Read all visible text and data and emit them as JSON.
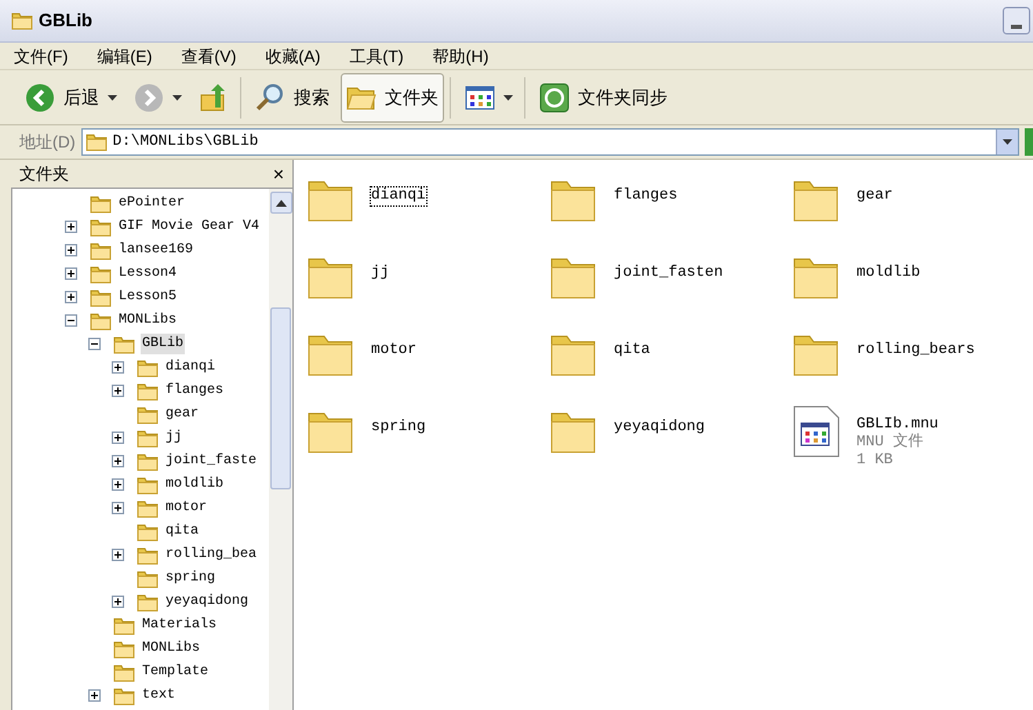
{
  "window": {
    "title": "GBLib"
  },
  "menu": [
    "文件(F)",
    "编辑(E)",
    "查看(V)",
    "收藏(A)",
    "工具(T)",
    "帮助(H)"
  ],
  "toolbar": [
    {
      "kind": "back",
      "label": "后退",
      "pressed": false
    },
    {
      "kind": "forward",
      "pressed": false
    },
    {
      "kind": "up",
      "pressed": false
    },
    {
      "kind": "search",
      "label": "搜索",
      "pressed": false
    },
    {
      "kind": "folders",
      "label": "文件夹",
      "pressed": true
    },
    {
      "kind": "views",
      "pressed": false
    },
    {
      "kind": "sync",
      "label": "文件夹同步",
      "pressed": false
    }
  ],
  "address": {
    "label": "地址(D)",
    "value": "D:\\MONLibs\\GBLib"
  },
  "folder_pane": {
    "title": "文件夹",
    "close": "×",
    "tree": [
      {
        "label": "ePointer",
        "kind": "leaf",
        "selected": false
      },
      {
        "label": "GIF Movie Gear V4",
        "kind": "branch",
        "expanded": false,
        "selected": false
      },
      {
        "label": "lansee169",
        "kind": "branch",
        "expanded": false,
        "selected": false
      },
      {
        "label": "Lesson4",
        "kind": "branch",
        "expanded": false,
        "selected": false
      },
      {
        "label": "Lesson5",
        "kind": "branch",
        "expanded": false,
        "selected": false
      },
      {
        "label": "MONLibs",
        "kind": "branch",
        "expanded": true,
        "selected": false,
        "children": [
          {
            "label": "GBLib",
            "kind": "branch",
            "expanded": true,
            "selected": true,
            "children": [
              {
                "label": "dianqi",
                "kind": "branch",
                "expanded": false,
                "selected": false
              },
              {
                "label": "flanges",
                "kind": "branch",
                "expanded": false,
                "selected": false
              },
              {
                "label": "gear",
                "kind": "leaf",
                "selected": false
              },
              {
                "label": "jj",
                "kind": "branch",
                "expanded": false,
                "selected": false
              },
              {
                "label": "joint_faste",
                "kind": "branch",
                "expanded": false,
                "selected": false
              },
              {
                "label": "moldlib",
                "kind": "branch",
                "expanded": false,
                "selected": false
              },
              {
                "label": "motor",
                "kind": "branch",
                "expanded": false,
                "selected": false
              },
              {
                "label": "qita",
                "kind": "leaf",
                "selected": false
              },
              {
                "label": "rolling_bea",
                "kind": "branch",
                "expanded": false,
                "selected": false
              },
              {
                "label": "spring",
                "kind": "leaf",
                "selected": false
              },
              {
                "label": "yeyaqidong",
                "kind": "branch",
                "expanded": false,
                "selected": false
              }
            ]
          },
          {
            "label": "Materials",
            "kind": "leaf",
            "selected": false
          },
          {
            "label": "MONLibs",
            "kind": "leaf",
            "selected": false
          },
          {
            "label": "Template",
            "kind": "leaf",
            "selected": false
          },
          {
            "label": "text",
            "kind": "branch",
            "expanded": false,
            "selected": false
          }
        ]
      }
    ]
  },
  "items": [
    {
      "kind": "folder",
      "name": "dianqi",
      "focused": true
    },
    {
      "kind": "folder",
      "name": "flanges",
      "focused": false
    },
    {
      "kind": "folder",
      "name": "gear",
      "focused": false
    },
    {
      "kind": "folder",
      "name": "jj",
      "focused": false
    },
    {
      "kind": "folder",
      "name": "joint_fasten",
      "focused": false
    },
    {
      "kind": "folder",
      "name": "moldlib",
      "focused": false
    },
    {
      "kind": "folder",
      "name": "motor",
      "focused": false
    },
    {
      "kind": "folder",
      "name": "qita",
      "focused": false
    },
    {
      "kind": "folder",
      "name": "rolling_bears",
      "focused": false
    },
    {
      "kind": "folder",
      "name": "spring",
      "focused": false
    },
    {
      "kind": "folder",
      "name": "yeyaqidong",
      "focused": false
    },
    {
      "kind": "file",
      "name": "GBLIb.mnu",
      "type": "MNU 文件",
      "size": "1 KB",
      "focused": false
    }
  ]
}
